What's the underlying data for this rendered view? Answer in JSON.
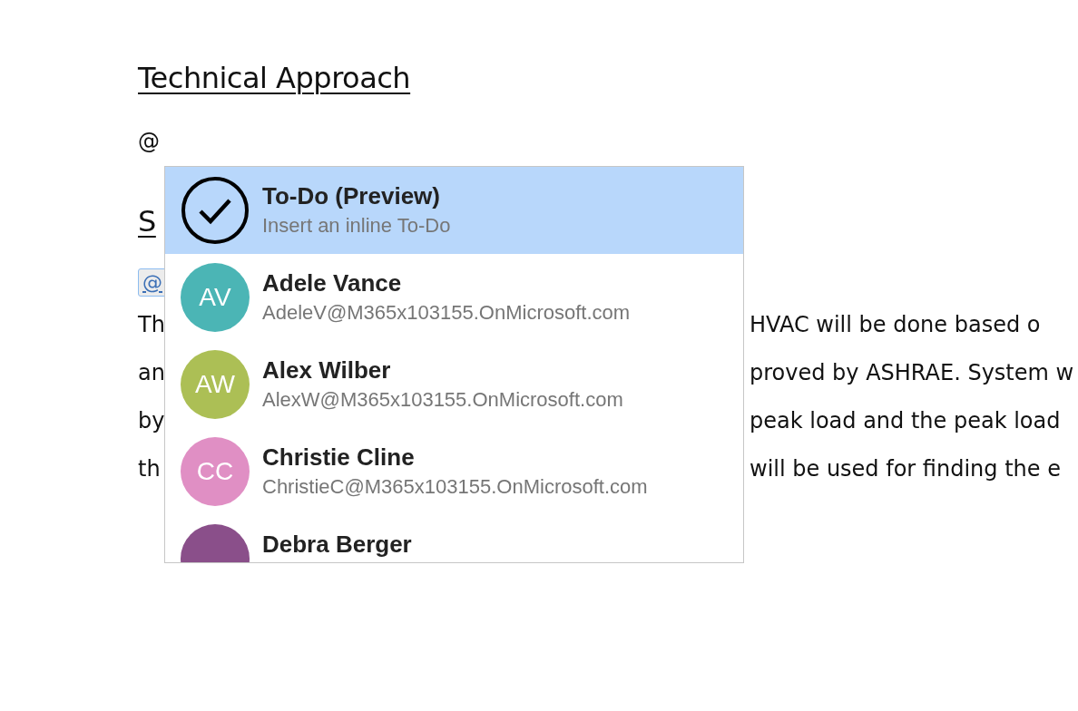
{
  "document": {
    "heading": "Technical Approach",
    "mention_text": "@",
    "heading_2": "S",
    "mention_chip": "@",
    "paragraph_lines": [
      {
        "start": "Th",
        "end": "HVAC will be done based o"
      },
      {
        "start": "an",
        "end": "proved by ASHRAE. System w"
      },
      {
        "start": "by",
        "end": "peak load and the peak load"
      },
      {
        "start": "th",
        "end": "will be used for finding the e"
      }
    ]
  },
  "mention_menu": {
    "items": [
      {
        "kind": "action",
        "title": "To-Do (Preview)",
        "subtitle": "Insert an inline To-Do",
        "selected": true
      },
      {
        "kind": "person",
        "initials": "AV",
        "title": "Adele Vance",
        "subtitle": "AdeleV@M365x103155.OnMicrosoft.com",
        "color": "#4bb5b5",
        "selected": false
      },
      {
        "kind": "person",
        "initials": "AW",
        "title": "Alex Wilber",
        "subtitle": "AlexW@M365x103155.OnMicrosoft.com",
        "color": "#acbf55",
        "selected": false
      },
      {
        "kind": "person",
        "initials": "CC",
        "title": "Christie Cline",
        "subtitle": "ChristieC@M365x103155.OnMicrosoft.com",
        "color": "#e08fc4",
        "selected": false
      },
      {
        "kind": "person",
        "title": "Debra Berger",
        "color": "#8a4f8a",
        "selected": false
      }
    ]
  }
}
